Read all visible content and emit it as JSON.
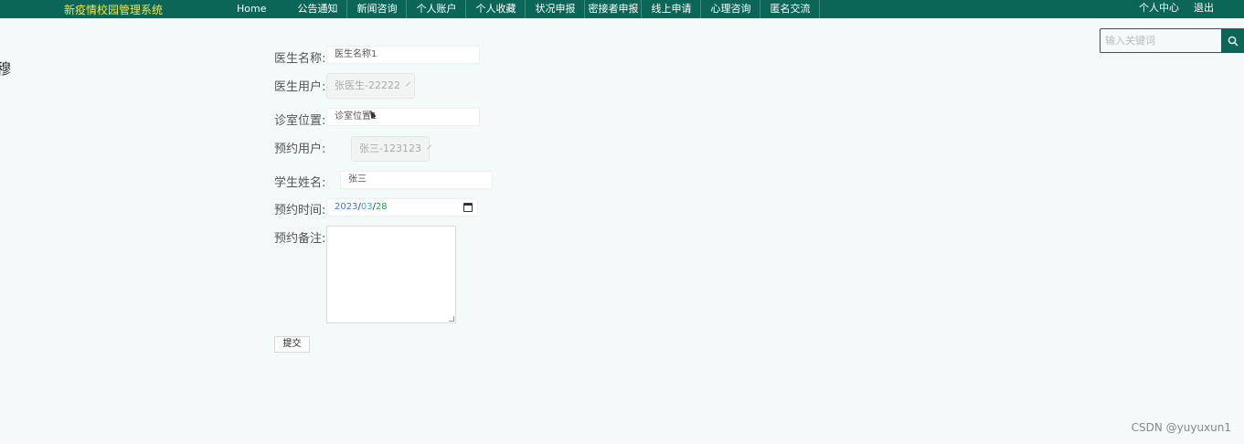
{
  "header": {
    "brand": "新疫情校园管理系统",
    "nav": [
      "Home",
      "公告通知",
      "新闻咨询",
      "个人账户",
      "个人收藏",
      "状况申报",
      "密接者申报",
      "线上申请",
      "心理咨询",
      "匿名交流"
    ],
    "right_links": [
      "个人中心",
      "退出"
    ]
  },
  "search": {
    "placeholder": "输入关键词"
  },
  "left_glyph": "穆",
  "form": {
    "doctor_name": {
      "label": "医生名称:",
      "value": "医生名称1"
    },
    "doctor_user": {
      "label": "医生用户:",
      "value": "张医生-22222"
    },
    "room": {
      "label": "诊室位置:",
      "value": "诊室位置1"
    },
    "booking_user": {
      "label": "预约用户:",
      "value": "张三-123123"
    },
    "student_name": {
      "label": "学生姓名:",
      "value": "张三"
    },
    "booking_time": {
      "label": "预约时间:",
      "year": "2023",
      "month": "03",
      "day": "28",
      "sep": "/"
    },
    "booking_note": {
      "label": "预约备注:",
      "value": ""
    },
    "submit_label": "提交"
  },
  "watermark": "CSDN @yuyuxun1",
  "colors": {
    "header_bg": "#0b6657",
    "brand": "#f2e64a",
    "page_bg": "#f4f9f9"
  },
  "icons": {
    "search": "search-icon",
    "calendar": "calendar-icon",
    "chevron": "chevron-down-icon"
  }
}
